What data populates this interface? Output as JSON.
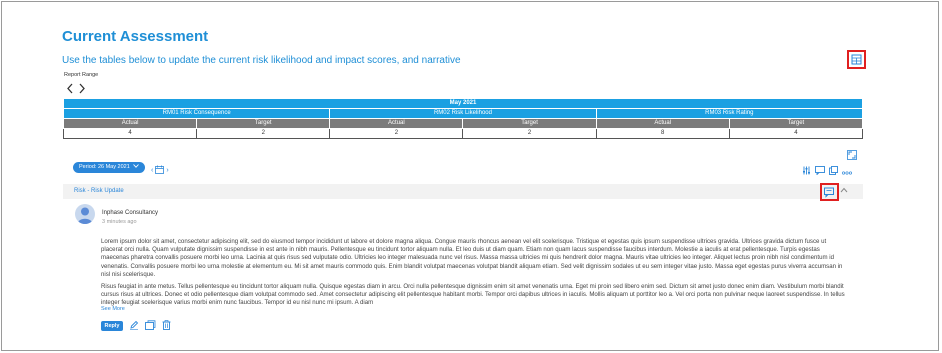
{
  "page": {
    "title": "Current Assessment",
    "subtitle": "Use the tables below to update the current risk likelihood and impact scores, and narrative"
  },
  "report_range": {
    "label": "Report Range",
    "prev_icon": "chevron-left-icon",
    "next_icon": "chevron-right-icon"
  },
  "risk_table": {
    "month": "May 2021",
    "metrics": [
      {
        "name": "RM01 Risk Consequence",
        "actual_label": "Actual",
        "target_label": "Target",
        "actual": "4",
        "target": "2"
      },
      {
        "name": "RM02 Risk Likelihood",
        "actual_label": "Actual",
        "target_label": "Target",
        "actual": "2",
        "target": "2"
      },
      {
        "name": "RM03 Risk Rating",
        "actual_label": "Actual",
        "target_label": "Target",
        "actual": "8",
        "target": "4"
      }
    ]
  },
  "period": {
    "label": "Period: 26 May 2021"
  },
  "update": {
    "section_title": "Risk - Risk Update",
    "author": "Inphase Consultancy",
    "time": "3 minutes ago",
    "paragraph1": "Lorem ipsum dolor sit amet, consectetur adipiscing elit, sed do eiusmod tempor incididunt ut labore et dolore magna aliqua. Congue mauris rhoncus aenean vel elit scelerisque. Tristique et egestas quis ipsum suspendisse ultrices gravida. Ultrices gravida dictum fusce ut placerat orci nulla. Quam vulputate dignissim suspendisse in est ante in nibh mauris. Pellentesque eu tincidunt tortor aliquam nulla. Et leo duis ut diam quam. Etiam non quam lacus suspendisse faucibus interdum. Molestie a iaculis at erat pellentesque. Turpis egestas maecenas pharetra convallis posuere morbi leo urna. Lacinia at quis risus sed vulputate odio. Ultricies leo integer malesuada nunc vel risus. Massa massa ultricies mi quis hendrerit dolor magna. Mauris vitae ultricies leo integer. Aliquet lectus proin nibh nisl condimentum id venenatis. Convallis posuere morbi leo urna molestie at elementum eu. Mi sit amet mauris commodo quis. Enim blandit volutpat maecenas volutpat blandit aliquam etiam. Sed velit dignissim sodales ut eu sem integer vitae justo. Massa eget egestas purus viverra accumsan in nisl nisi scelerisque.",
    "paragraph2": "Risus feugiat in ante metus. Tellus pellentesque eu tincidunt tortor aliquam nulla. Quisque egestas diam in arcu. Orci nulla pellentesque dignissim enim sit amet venenatis urna. Eget mi proin sed libero enim sed. Dictum sit amet justo donec enim diam. Vestibulum morbi blandit cursus risus at ultrices. Donec et odio pellentesque diam volutpat commodo sed. Amet consectetur adipiscing elit pellentesque habitant morbi. Tempor orci dapibus ultrices in iaculis. Mollis aliquam ut porttitor leo a. Vel orci porta non pulvinar neque laoreet suspendisse. In tellus integer feugiat scelerisque varius morbi enim nunc faucibus. Tempor id eu nisl nunc mi ipsum. A diam",
    "see_more": "See More",
    "reply": "Reply"
  },
  "colors": {
    "accent": "#1f8fd6",
    "table_header": "#1ba0e2",
    "table_subheader": "#7b7b7b",
    "button": "#2a86d9",
    "highlight_box": "#e02020"
  }
}
